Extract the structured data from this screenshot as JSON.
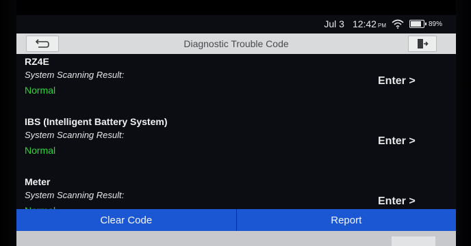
{
  "status_bar": {
    "date": "Jul 3",
    "time": "12:42",
    "ampm": "PM",
    "battery_pct": "89%",
    "battery_level": 0.89
  },
  "header": {
    "title": "Diagnostic Trouble Code",
    "back_icon": "back-arrow-icon",
    "exit_icon": "exit-door-icon"
  },
  "systems": [
    {
      "name": "RZ4E",
      "label": "System Scanning Result:",
      "result": "Normal",
      "action": "Enter >"
    },
    {
      "name": "IBS (Intelligent Battery System)",
      "label": "System Scanning Result:",
      "result": "Normal",
      "action": "Enter >"
    },
    {
      "name": "Meter",
      "label": "System Scanning Result:",
      "result": "Normal",
      "action": "Enter >"
    }
  ],
  "footer": {
    "clear_code_label": "Clear Code",
    "report_label": "Report"
  },
  "colors": {
    "accent": "#1b57d3",
    "result_normal": "#2fd33a",
    "header_bg": "#d9dadc"
  }
}
